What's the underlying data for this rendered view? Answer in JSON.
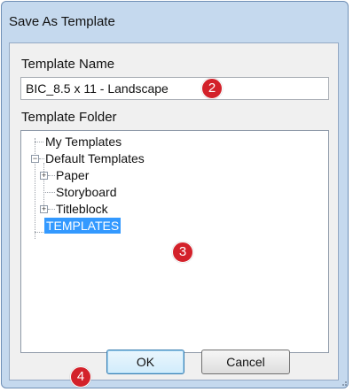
{
  "window": {
    "title": "Save As Template"
  },
  "form": {
    "template_name_label": "Template Name",
    "template_name_value": "BIC_8.5 x 11 - Landscape",
    "template_folder_label": "Template Folder"
  },
  "tree": {
    "items": [
      {
        "label": "My Templates",
        "expander": null,
        "selected": false
      },
      {
        "label": "Default Templates",
        "expander": "−",
        "selected": false
      },
      {
        "label": "Paper",
        "expander": "+",
        "selected": false
      },
      {
        "label": "Storyboard",
        "expander": null,
        "selected": false
      },
      {
        "label": "Titleblock",
        "expander": "+",
        "selected": false
      },
      {
        "label": "TEMPLATES",
        "expander": null,
        "selected": true
      }
    ]
  },
  "buttons": {
    "ok": "OK",
    "cancel": "Cancel"
  },
  "callouts": {
    "name_badge": "2",
    "tree_badge": "3",
    "ok_badge": "4"
  },
  "colors": {
    "selection": "#3399ff",
    "badge": "#d3212a",
    "frame": "#c5d9ee"
  }
}
